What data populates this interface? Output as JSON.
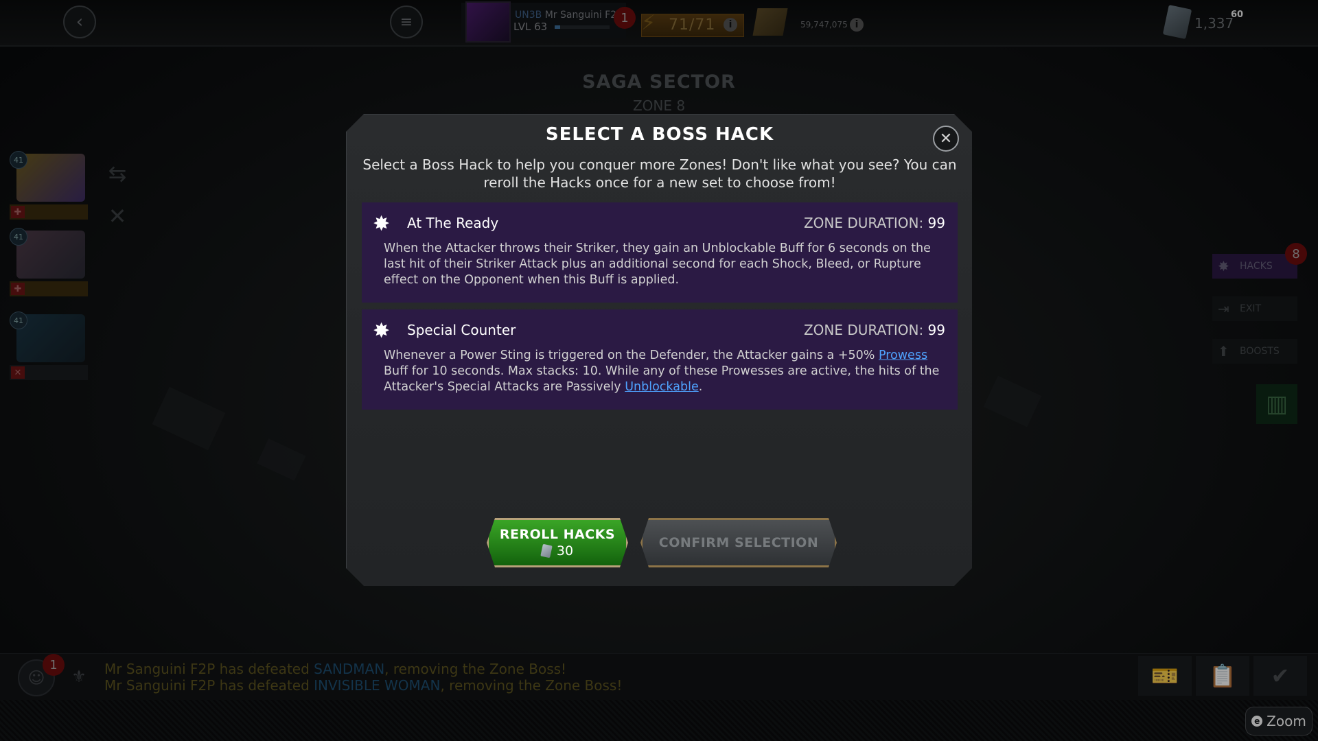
{
  "topbar": {
    "back_icon": "back-arrow-icon",
    "menu_icon": "hamburger-menu-icon",
    "player_tag": "UN3B",
    "player_name": "Mr Sanguini F2P",
    "level": "LVL 63",
    "xp_fraction": 0.1,
    "notification_count": "1",
    "energy": "71/71",
    "gold": "59,747,075",
    "units": "1,337",
    "units_superscript": "60"
  },
  "background": {
    "sector_title": "SAGA SECTOR",
    "zone": "ZONE 8"
  },
  "roster": {
    "levels": [
      "41",
      "41",
      "41"
    ]
  },
  "right_menu": {
    "hacks_label": "HACKS",
    "hacks_badge": "8",
    "exit_label": "EXIT",
    "boosts_label": "BOOSTS"
  },
  "modal": {
    "title": "SELECT A BOSS HACK",
    "description": "Select a Boss Hack to help you conquer more Zones! Don't like what you see? You can reroll the Hacks once for a new set to choose from!",
    "close_icon": "close-x-icon",
    "hacks": [
      {
        "name": "At The Ready",
        "duration_label": "ZONE DURATION:",
        "duration_value": "99",
        "description": "When the Attacker throws their Striker, they gain an Unblockable Buff for 6 seconds on the last hit of their Striker Attack plus an additional second for each Shock, Bleed, or Rupture effect on the Opponent when this Buff is applied."
      },
      {
        "name": "Special Counter",
        "duration_label": "ZONE DURATION:",
        "duration_value": "99",
        "desc_part1": "Whenever a Power Sting is triggered on the Defender, the Attacker gains a +50% ",
        "link1": "Prowess",
        "desc_part2": " Buff for 10 seconds. Max stacks: 10. While any of these Prowesses are active, the hits of the Attacker's Special Attacks are Passively ",
        "link2": "Unblockable",
        "desc_part3": "."
      }
    ],
    "reroll_label": "REROLL HACKS",
    "reroll_cost": "30",
    "confirm_label": "CONFIRM SELECTION"
  },
  "feed": {
    "badge": "1",
    "line1_pre": "Mr Sanguini F2P has defeated ",
    "line1_name": "SANDMAN",
    "line1_post": ", removing the Zone Boss!",
    "line2_pre": "Mr Sanguini F2P has defeated ",
    "line2_name": "INVISIBLE WOMAN",
    "line2_post": ", removing the Zone Boss!"
  },
  "zoom_label": "Zoom",
  "colors": {
    "hack_panel": "#2b1a44",
    "reroll_green": "#2f9421",
    "link_blue": "#4fa3ff"
  }
}
